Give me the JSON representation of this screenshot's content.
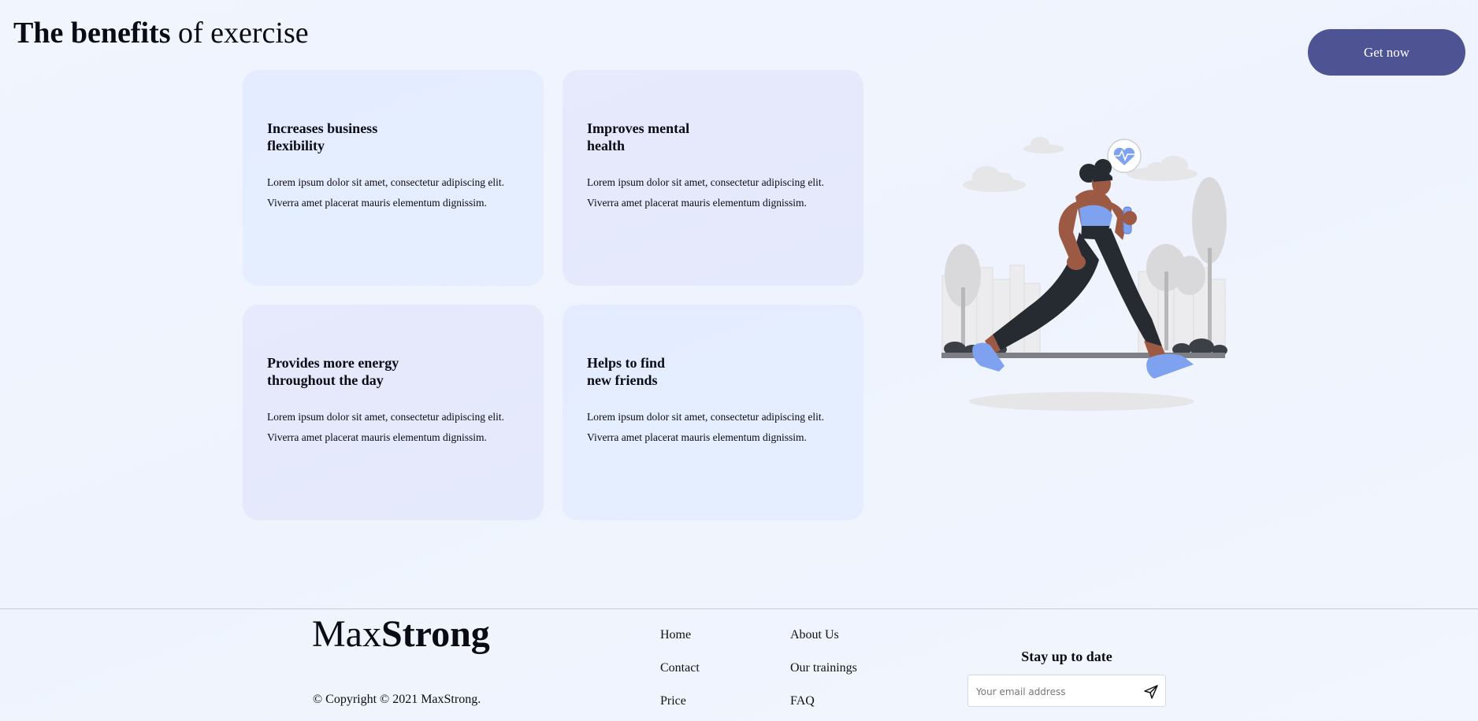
{
  "header": {
    "title_bold": "The benefits",
    "title_rest": " of exercise",
    "cta_label": "Get now"
  },
  "cards": [
    {
      "title": "Increases business\nflexibility",
      "text": "Lorem ipsum dolor sit amet, consectetur adipiscing elit. Viverra amet placerat mauris elementum dignissim."
    },
    {
      "title": "Improves mental\nhealth",
      "text": "Lorem ipsum dolor sit amet, consectetur adipiscing elit. Viverra amet placerat mauris elementum dignissim."
    },
    {
      "title": "Provides more energy\nthroughout the day",
      "text": "Lorem ipsum dolor sit amet, consectetur adipiscing elit. Viverra amet placerat mauris elementum dignissim."
    },
    {
      "title": "Helps to find\nnew friends",
      "text": "Lorem ipsum dolor sit amet, consectetur adipiscing elit. Viverra amet placerat mauris elementum dignissim."
    }
  ],
  "illustration": {
    "icon": "running-woman-illustration"
  },
  "footer": {
    "brand_light": "Max",
    "brand_bold": "Strong",
    "copyright": "© Copyright © 2021 MaxStrong.",
    "nav": [
      {
        "label": "Home"
      },
      {
        "label": "About Us"
      },
      {
        "label": "Contact"
      },
      {
        "label": "Our trainings"
      },
      {
        "label": "Price"
      },
      {
        "label": "FAQ"
      }
    ],
    "newsletter": {
      "title": "Stay up to date",
      "placeholder": "Your email address",
      "send_icon": "send-icon"
    }
  },
  "colors": {
    "accent": "#4e5394",
    "card_blue": "#e3edff",
    "card_lavender": "#e7e9fc",
    "shoe": "#7ea2f0"
  }
}
